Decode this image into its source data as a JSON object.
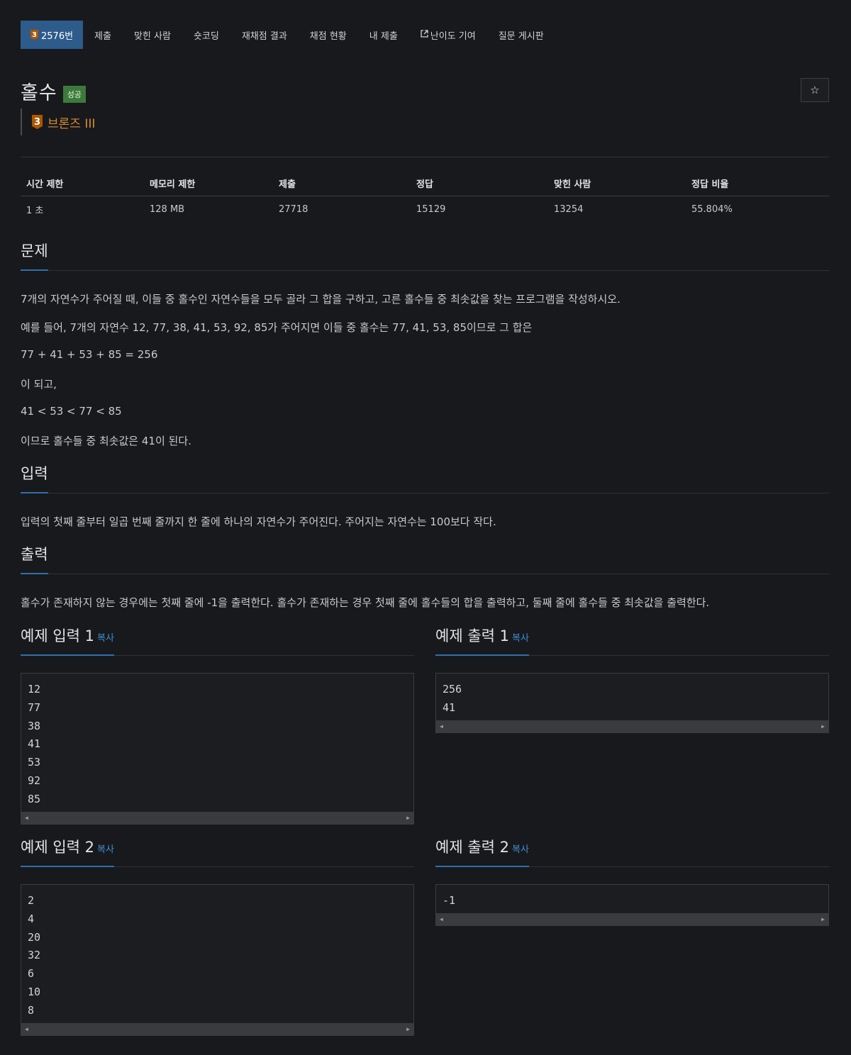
{
  "nav": {
    "problem_tab": {
      "tier_num": "3",
      "label": "2576번"
    },
    "items": [
      {
        "label": "제출"
      },
      {
        "label": "맞힌 사람"
      },
      {
        "label": "숏코딩"
      },
      {
        "label": "재채점 결과"
      },
      {
        "label": "채점 현황"
      },
      {
        "label": "내 제출"
      },
      {
        "label": "난이도 기여",
        "icon": "external-link-icon"
      },
      {
        "label": "질문 게시판"
      }
    ]
  },
  "header": {
    "title": "홀수",
    "status": "성공",
    "star_icon": "☆",
    "tier_num": "3",
    "tier_label": "브론즈 III"
  },
  "colors": {
    "accent": "#2d5b8a",
    "tier": "#ad5600",
    "success": "#3c7a3c",
    "link": "#3d8fd6"
  },
  "stats": {
    "headers": [
      "시간 제한",
      "메모리 제한",
      "제출",
      "정답",
      "맞힌 사람",
      "정답 비율"
    ],
    "values": [
      "1 초",
      "128 MB",
      "27718",
      "15129",
      "13254",
      "55.804%"
    ]
  },
  "problem": {
    "heading": "문제",
    "lines": [
      "7개의 자연수가 주어질 때, 이들 중 홀수인 자연수들을 모두 골라 그 합을 구하고, 고른 홀수들 중 최솟값을 찾는 프로그램을 작성하시오.",
      "예를 들어, 7개의 자연수 12, 77, 38, 41, 53, 92, 85가 주어지면 이들 중 홀수는 77, 41, 53, 85이므로 그 합은",
      "77 + 41 + 53 + 85 = 256",
      "이 되고,",
      "41 < 53 < 77 < 85",
      "이므로 홀수들 중 최솟값은 41이 된다."
    ]
  },
  "input": {
    "heading": "입력",
    "text": "입력의 첫째 줄부터 일곱 번째 줄까지 한 줄에 하나의 자연수가 주어진다. 주어지는 자연수는 100보다 작다."
  },
  "output": {
    "heading": "출력",
    "text": "홀수가 존재하지 않는 경우에는 첫째 줄에 -1을 출력한다. 홀수가 존재하는 경우 첫째 줄에 홀수들의 합을 출력하고, 둘째 줄에 홀수들 중 최솟값을 출력한다."
  },
  "samples": [
    {
      "in_title": "예제 입력 1",
      "out_title": "예제 출력 1",
      "copy": "복사",
      "input": [
        "12",
        "77",
        "38",
        "41",
        "53",
        "92",
        "85"
      ],
      "output": [
        "256",
        "41"
      ]
    },
    {
      "in_title": "예제 입력 2",
      "out_title": "예제 출력 2",
      "copy": "복사",
      "input": [
        "2",
        "4",
        "20",
        "32",
        "6",
        "10",
        "8"
      ],
      "output": [
        "-1"
      ]
    }
  ]
}
